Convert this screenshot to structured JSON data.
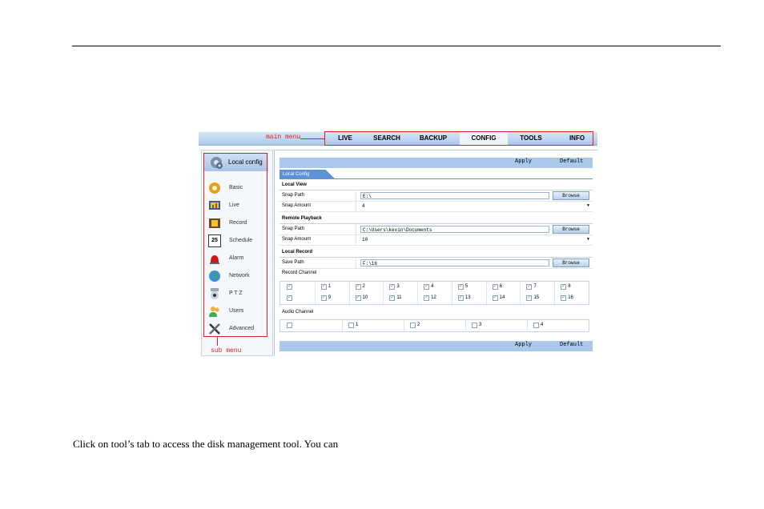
{
  "main_menu": {
    "label": "main menu",
    "tabs": [
      {
        "label": "LIVE"
      },
      {
        "label": "SEARCH"
      },
      {
        "label": "BACKUP"
      },
      {
        "label": "CONFIG",
        "active": true
      },
      {
        "label": "TOOLS"
      },
      {
        "label": "INFO"
      }
    ]
  },
  "sub_menu": {
    "label": "sub menu",
    "header": "Local config",
    "items": [
      {
        "label": "Basic",
        "icon": "gear-icon"
      },
      {
        "label": "Live",
        "icon": "monitor-icon"
      },
      {
        "label": "Record",
        "icon": "film-icon"
      },
      {
        "label": "Schedule",
        "icon": "calendar-icon",
        "badge": "25"
      },
      {
        "label": "Alarm",
        "icon": "alarm-icon"
      },
      {
        "label": "Network",
        "icon": "globe-icon"
      },
      {
        "label": "P T Z",
        "icon": "camera-icon"
      },
      {
        "label": "Users",
        "icon": "users-icon"
      },
      {
        "label": "Advanced",
        "icon": "tools-icon"
      }
    ]
  },
  "toolbar": {
    "apply": "Apply",
    "default": "Default"
  },
  "subtab": "Local Config",
  "local_view": {
    "title": "Local View",
    "snap_path_label": "Snap Path",
    "snap_path_value": "E:\\",
    "snap_amount_label": "Snap Amount",
    "snap_amount_value": "4",
    "browse": "Browse"
  },
  "remote_playback": {
    "title": "Remote Playback",
    "snap_path_label": "Snap Path",
    "snap_path_value": "C:\\Users\\kevin\\Documents",
    "snap_amount_label": "Snap Amount",
    "snap_amount_value": "10",
    "browse": "Browse"
  },
  "local_record": {
    "title": "Local Record",
    "save_path_label": "Save Path",
    "save_path_value": "F:\\16",
    "browse": "Browse"
  },
  "record_channel": {
    "title": "Record Channel",
    "rows": [
      [
        "",
        "1",
        "2",
        "3",
        "4",
        "5",
        "6",
        "7",
        "8"
      ],
      [
        "",
        "9",
        "10",
        "11",
        "12",
        "13",
        "14",
        "15",
        "16"
      ]
    ]
  },
  "audio_channel": {
    "title": "Audio Channel",
    "cells": [
      "",
      "1",
      "2",
      "3",
      "4"
    ]
  },
  "caption": "Click on tool’s tab to access the disk management tool. You can",
  "colors": {
    "accent": "#a9c8ea",
    "annotation": "#e02020",
    "subtab": "#5f92d1"
  }
}
